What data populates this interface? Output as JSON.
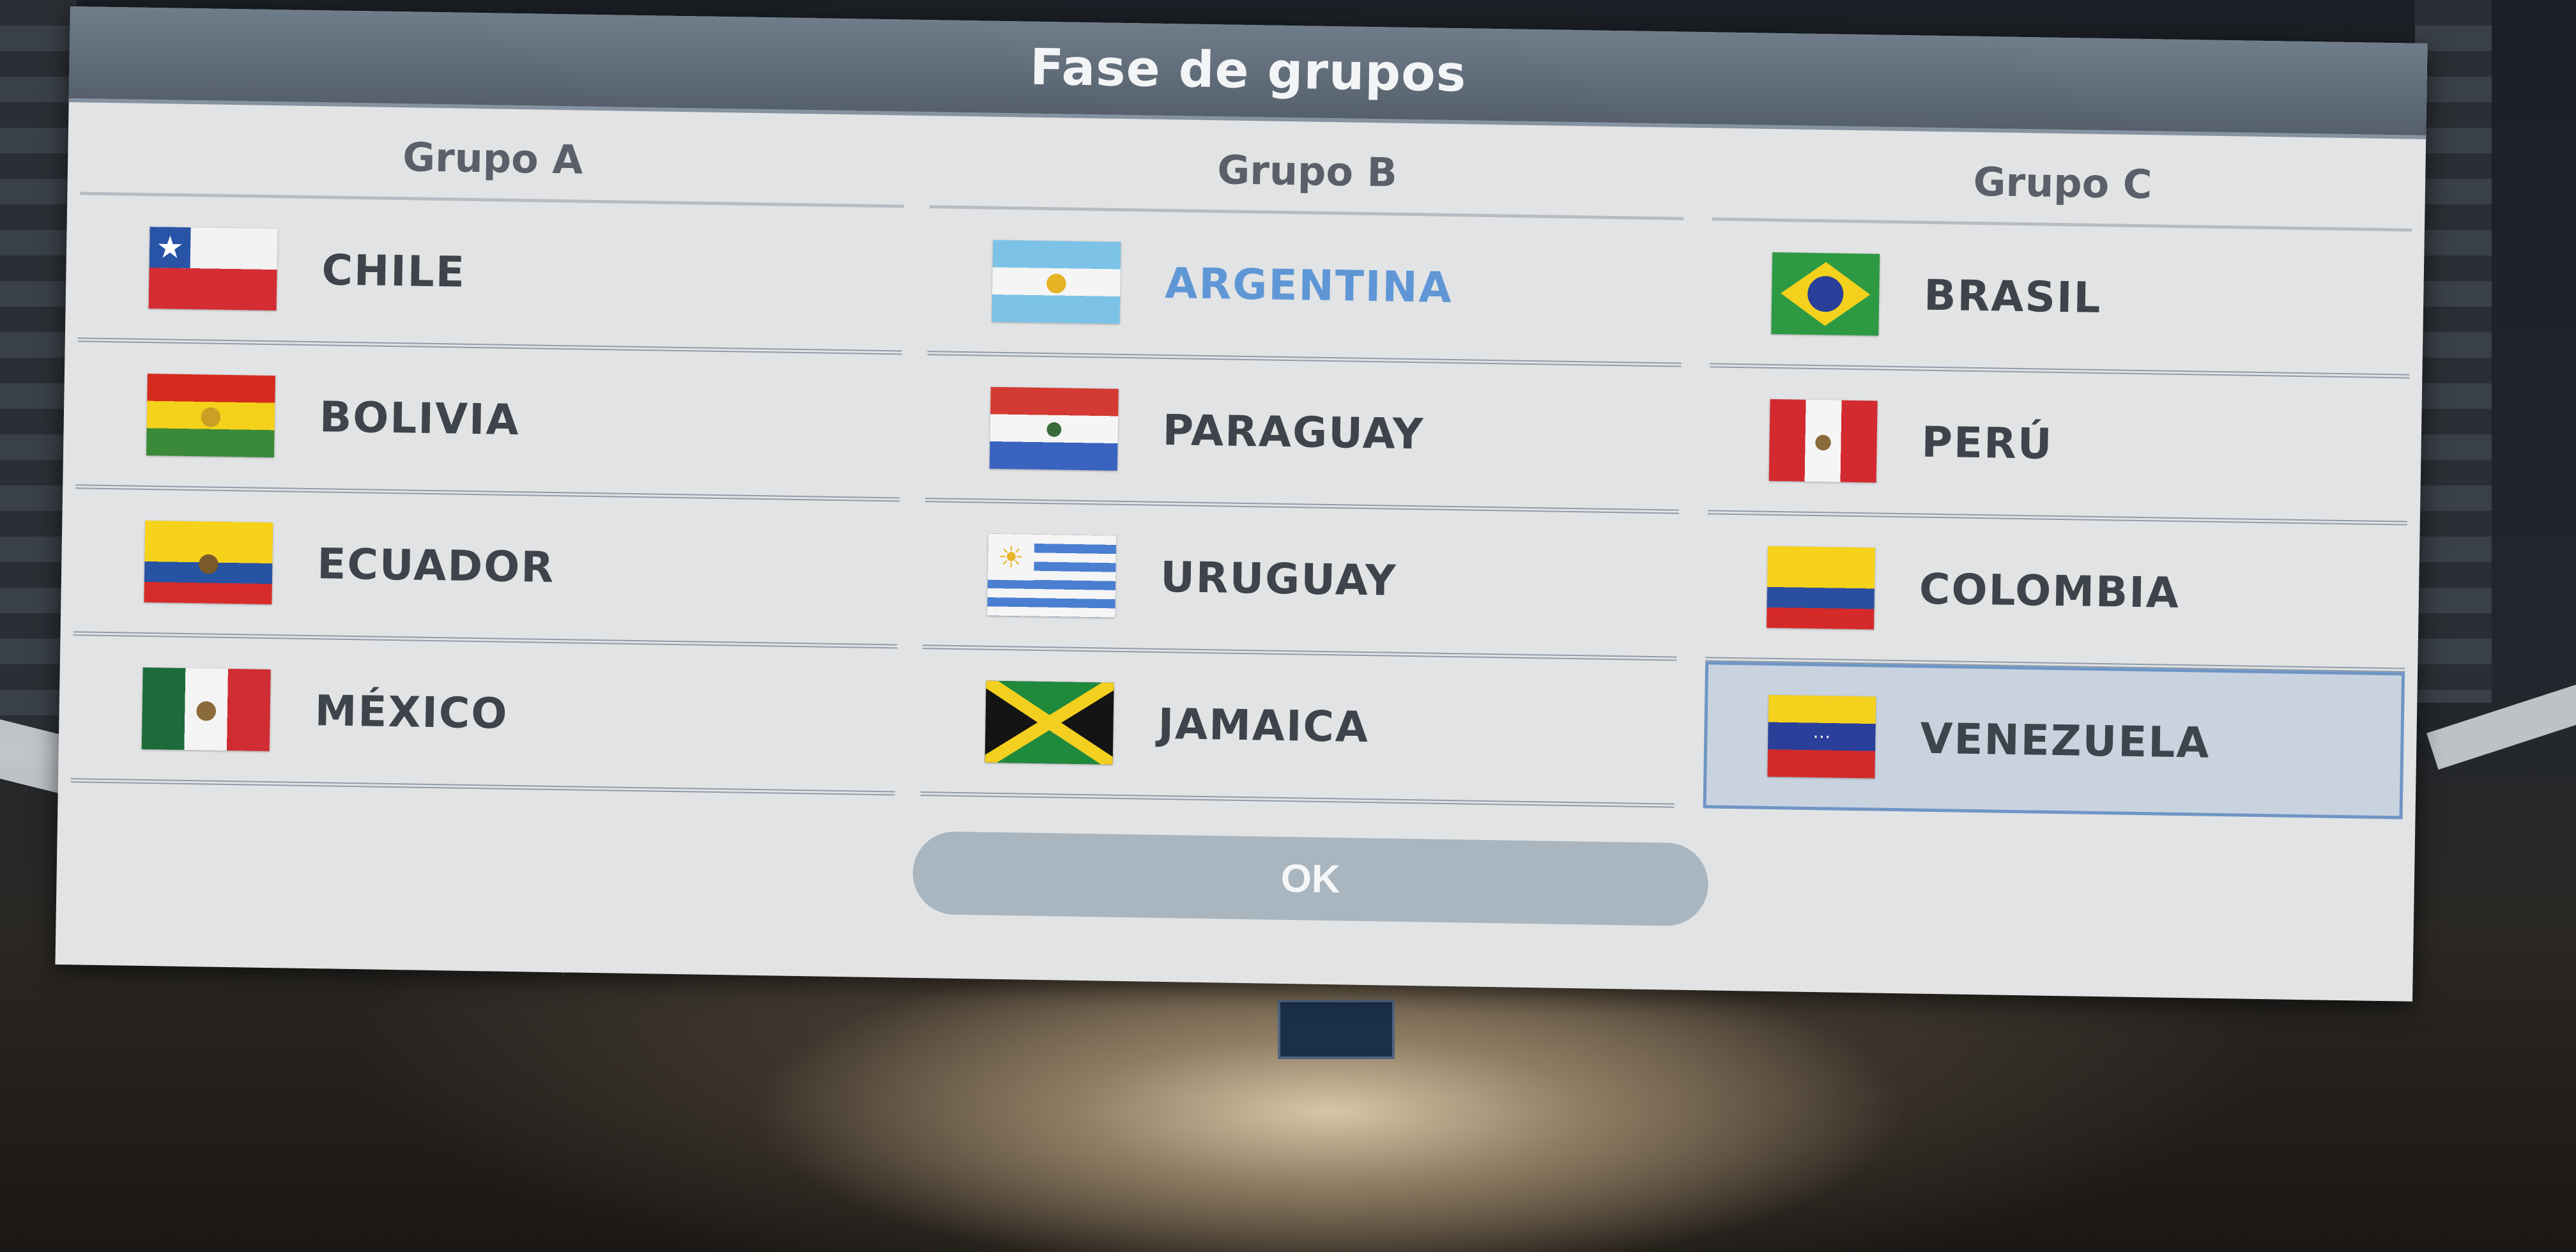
{
  "dialog": {
    "title": "Fase de grupos",
    "ok_label": "OK"
  },
  "groups": [
    {
      "title": "Grupo A",
      "teams": [
        {
          "name": "CHILE",
          "flag": "chile-flag"
        },
        {
          "name": "BOLIVIA",
          "flag": "bolivia-flag"
        },
        {
          "name": "ECUADOR",
          "flag": "ecuador-flag"
        },
        {
          "name": "MÉXICO",
          "flag": "mexico-flag"
        }
      ]
    },
    {
      "title": "Grupo B",
      "teams": [
        {
          "name": "ARGENTINA",
          "flag": "argentina-flag",
          "highlighted": true
        },
        {
          "name": "PARAGUAY",
          "flag": "paraguay-flag"
        },
        {
          "name": "URUGUAY",
          "flag": "uruguay-flag"
        },
        {
          "name": "JAMAICA",
          "flag": "jamaica-flag"
        }
      ]
    },
    {
      "title": "Grupo C",
      "teams": [
        {
          "name": "BRASIL",
          "flag": "brasil-flag"
        },
        {
          "name": "PERÚ",
          "flag": "peru-flag"
        },
        {
          "name": "COLOMBIA",
          "flag": "colombia-flag"
        },
        {
          "name": "VENEZUELA",
          "flag": "venezuela-flag",
          "selected": true
        }
      ]
    }
  ],
  "colors": {
    "highlight_text": "#5f97d6",
    "selection_border": "#6f95c6",
    "header_bg": "#5f6b78",
    "ok_button_bg": "#a9b6c0"
  }
}
